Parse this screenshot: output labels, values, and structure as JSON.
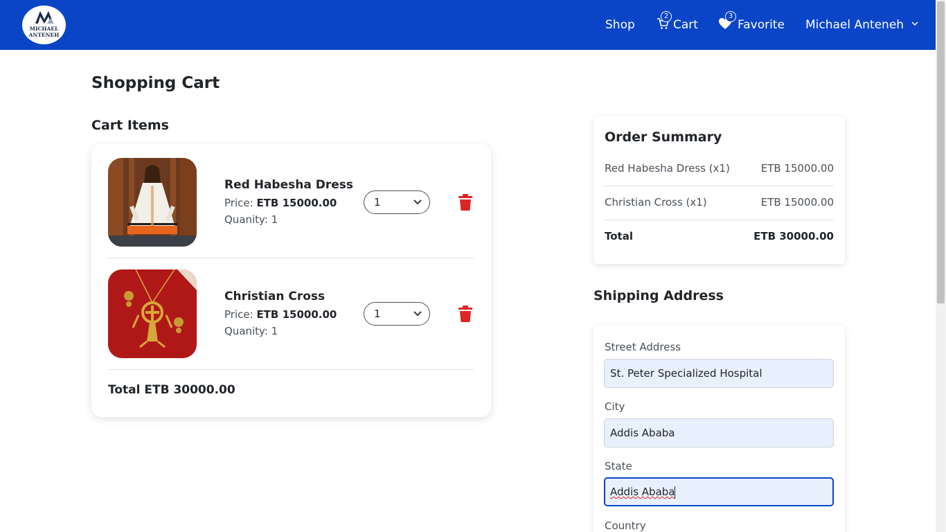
{
  "navbar": {
    "logo_line1": "MICHAEL",
    "logo_line2": "ANTENEH",
    "shop_label": "Shop",
    "cart_label": "Cart",
    "cart_count": "2",
    "favorite_label": "Favorite",
    "favorite_count": "3",
    "user_name": "Michael Anteneh",
    "background_color": "#0a45c8"
  },
  "page": {
    "title": "Shopping Cart",
    "cart_items_heading": "Cart Items"
  },
  "cart": {
    "items": [
      {
        "name": "Red Habesha Dress",
        "price_label": "Price:",
        "price_value": "ETB 15000.00",
        "quantity_text": "Quanity: 1",
        "selected_qty": "1",
        "image_icon": "habesha-dress-photo"
      },
      {
        "name": "Christian Cross",
        "price_label": "Price:",
        "price_value": "ETB 15000.00",
        "quantity_text": "Quanity: 1",
        "selected_qty": "1",
        "image_icon": "cross-necklace-photo"
      }
    ],
    "total_text": "Total ETB 30000.00",
    "delete_color": "#dc2626"
  },
  "summary": {
    "title": "Order Summary",
    "rows": [
      {
        "label": "Red Habesha Dress (x1)",
        "value": "ETB 15000.00"
      },
      {
        "label": "Christian Cross (x1)",
        "value": "ETB 15000.00"
      }
    ],
    "total_label": "Total",
    "total_value": "ETB 30000.00"
  },
  "shipping": {
    "title": "Shipping Address",
    "street_label": "Street Address",
    "street_value": "St. Peter Specialized Hospital",
    "city_label": "City",
    "city_value": "Addis Ababa",
    "state_label": "State",
    "state_value": "Addis Ababa",
    "country_label": "Country"
  }
}
